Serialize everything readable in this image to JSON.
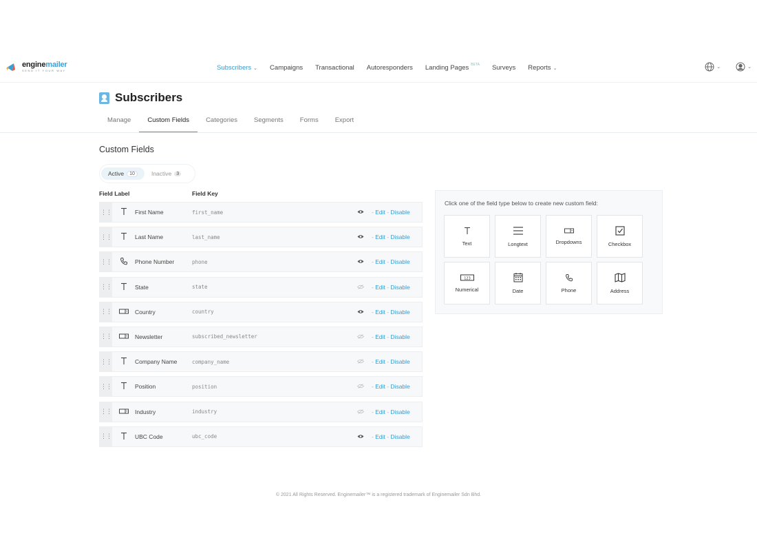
{
  "brand": {
    "name_prefix": "engine",
    "name_suffix": "mailer",
    "tagline": "SEND IT YOUR WAY"
  },
  "nav": [
    {
      "label": "Subscribers",
      "active": true,
      "dropdown": true
    },
    {
      "label": "Campaigns"
    },
    {
      "label": "Transactional"
    },
    {
      "label": "Autoresponders"
    },
    {
      "label": "Landing Pages",
      "badge": "BETA"
    },
    {
      "label": "Surveys"
    },
    {
      "label": "Reports",
      "dropdown": true
    }
  ],
  "page": {
    "title": "Subscribers"
  },
  "tabs": [
    "Manage",
    "Custom Fields",
    "Categories",
    "Segments",
    "Forms",
    "Export"
  ],
  "section_title": "Custom Fields",
  "filter": {
    "active_label": "Active",
    "active_count": "10",
    "inactive_label": "Inactive",
    "inactive_count": "3"
  },
  "columns": {
    "label": "Field Label",
    "key": "Field Key"
  },
  "actions": {
    "edit": "Edit",
    "disable": "Disable"
  },
  "fields": [
    {
      "label": "First Name",
      "key": "first_name",
      "icon": "text-icon",
      "visible": true
    },
    {
      "label": "Last Name",
      "key": "last_name",
      "icon": "text-icon",
      "visible": true
    },
    {
      "label": "Phone Number",
      "key": "phone",
      "icon": "phone-icon",
      "visible": true
    },
    {
      "label": "State",
      "key": "state",
      "icon": "text-icon",
      "visible": false
    },
    {
      "label": "Country",
      "key": "country",
      "icon": "dropdown-icon",
      "visible": true
    },
    {
      "label": "Newsletter",
      "key": "subscribed_newsletter",
      "icon": "dropdown-icon",
      "visible": false
    },
    {
      "label": "Company Name",
      "key": "company_name",
      "icon": "text-icon",
      "visible": false
    },
    {
      "label": "Position",
      "key": "position",
      "icon": "text-icon",
      "visible": false
    },
    {
      "label": "Industry",
      "key": "industry",
      "icon": "dropdown-icon",
      "visible": false
    },
    {
      "label": "UBC Code",
      "key": "ubc_code",
      "icon": "text-icon",
      "visible": true
    }
  ],
  "panel": {
    "hint": "Click one of the field type below to create new custom field:",
    "types": [
      {
        "label": "Text",
        "icon": "text-icon"
      },
      {
        "label": "Longtext",
        "icon": "longtext-icon"
      },
      {
        "label": "Dropdowns",
        "icon": "dropdown-icon"
      },
      {
        "label": "Checkbox",
        "icon": "checkbox-icon"
      },
      {
        "label": "Numerical",
        "icon": "numerical-icon"
      },
      {
        "label": "Date",
        "icon": "calendar-icon"
      },
      {
        "label": "Phone",
        "icon": "phone-icon"
      },
      {
        "label": "Address",
        "icon": "map-icon"
      }
    ]
  },
  "footer": "© 2021 All Rights Reserved. Enginemailer™ is a registered trademark of Enginemailer Sdn Bhd.",
  "colors": {
    "accent": "#3a9bd0",
    "icon_blue": "#6fb7e3"
  }
}
